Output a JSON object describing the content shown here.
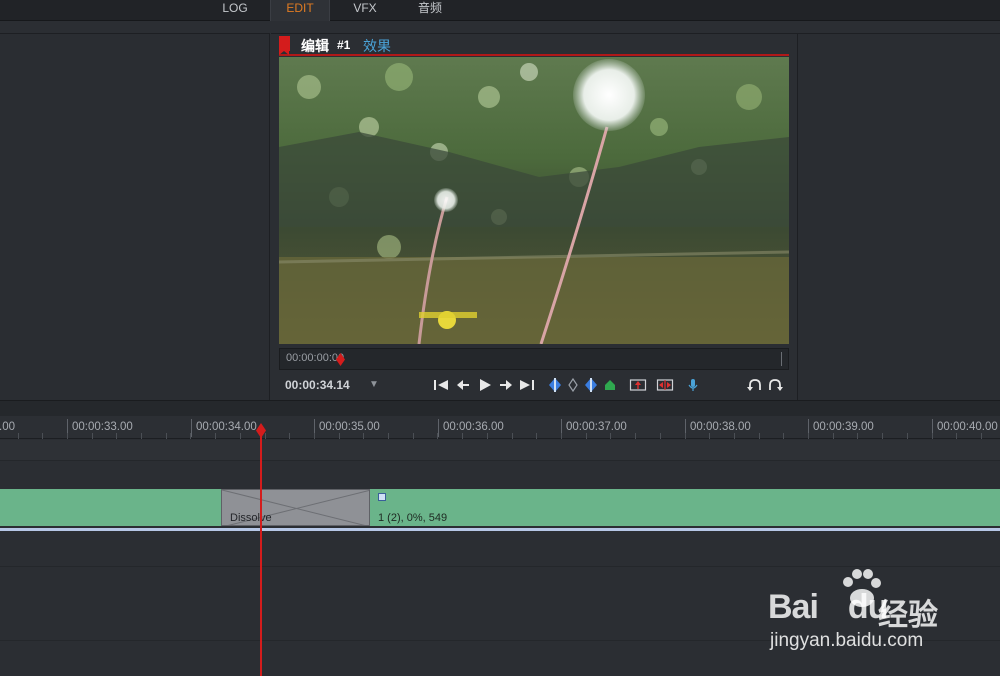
{
  "tabs": [
    {
      "label": "LOG",
      "active": false
    },
    {
      "label": "EDIT",
      "active": true
    },
    {
      "label": "VFX",
      "active": false
    },
    {
      "label": "音频",
      "active": false
    }
  ],
  "viewer": {
    "title": "编辑",
    "number": "#1",
    "effects_link": "效果",
    "scrub_timecode": "00:00:00:00",
    "timecode": "00:00:34.14",
    "timecode_dropdown": "▼"
  },
  "transport": {
    "icons": [
      "go-to-start-icon",
      "step-back-icon",
      "play-icon",
      "step-forward-icon",
      "go-to-end-icon",
      "mark-in-icon",
      "mark-clear-icon",
      "mark-out-icon",
      "add-cue-icon",
      "lift-icon",
      "extract-icon",
      "voiceover-mic-icon",
      "undo-icon",
      "redo-icon"
    ]
  },
  "timeline": {
    "ruler": [
      {
        "label": ".00"
      },
      {
        "label": "00:00:33.00"
      },
      {
        "label": "00:00:34.00"
      },
      {
        "label": "00:00:35.00"
      },
      {
        "label": "00:00:36.00"
      },
      {
        "label": "00:00:37.00"
      },
      {
        "label": "00:00:38.00"
      },
      {
        "label": "00:00:39.00"
      },
      {
        "label": "00:00:40.00"
      }
    ],
    "transition_label": "Dissolve",
    "clip_label": "1 (2), 0%, 549",
    "playhead_time": "00:00:34.14"
  },
  "colors": {
    "accent_tab": "#e07b22",
    "clip": "#6ab48a",
    "playhead": "#d41c1c",
    "effects_link": "#4aa3d8"
  },
  "watermark": {
    "brand": "Bai",
    "brand2": "du",
    "cn": "经验",
    "url": "jingyan.baidu.com"
  }
}
